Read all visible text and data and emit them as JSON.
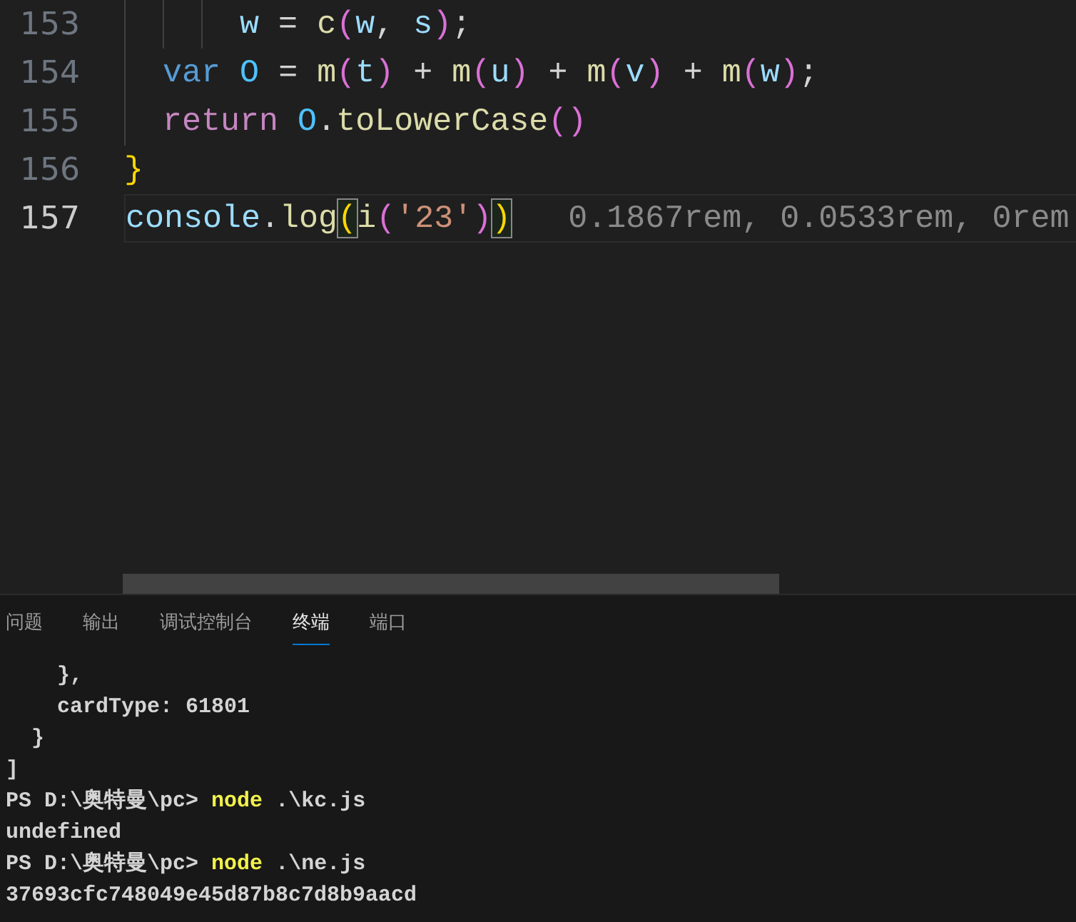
{
  "editor": {
    "lines": [
      {
        "number": "153",
        "current": false,
        "tokens": [
          {
            "kind": "variable",
            "text": "      w"
          },
          {
            "kind": "plain",
            "text": " = "
          },
          {
            "kind": "function",
            "text": "c"
          },
          {
            "kind": "bracket2",
            "text": "("
          },
          {
            "kind": "variable",
            "text": "w"
          },
          {
            "kind": "plain",
            "text": ", "
          },
          {
            "kind": "variable",
            "text": "s"
          },
          {
            "kind": "bracket2",
            "text": ")"
          },
          {
            "kind": "plain",
            "text": ";"
          }
        ]
      },
      {
        "number": "154",
        "current": false,
        "tokens": [
          {
            "kind": "keyword",
            "text": "  var "
          },
          {
            "kind": "constant",
            "text": "O"
          },
          {
            "kind": "plain",
            "text": " = "
          },
          {
            "kind": "function",
            "text": "m"
          },
          {
            "kind": "bracket2",
            "text": "("
          },
          {
            "kind": "variable",
            "text": "t"
          },
          {
            "kind": "bracket2",
            "text": ")"
          },
          {
            "kind": "plain",
            "text": " + "
          },
          {
            "kind": "function",
            "text": "m"
          },
          {
            "kind": "bracket2",
            "text": "("
          },
          {
            "kind": "variable",
            "text": "u"
          },
          {
            "kind": "bracket2",
            "text": ")"
          },
          {
            "kind": "plain",
            "text": " + "
          },
          {
            "kind": "function",
            "text": "m"
          },
          {
            "kind": "bracket2",
            "text": "("
          },
          {
            "kind": "variable",
            "text": "v"
          },
          {
            "kind": "bracket2",
            "text": ")"
          },
          {
            "kind": "plain",
            "text": " + "
          },
          {
            "kind": "function",
            "text": "m"
          },
          {
            "kind": "bracket2",
            "text": "("
          },
          {
            "kind": "variable",
            "text": "w"
          },
          {
            "kind": "bracket2",
            "text": ")"
          },
          {
            "kind": "plain",
            "text": ";"
          }
        ]
      },
      {
        "number": "155",
        "current": false,
        "tokens": [
          {
            "kind": "control",
            "text": "  return "
          },
          {
            "kind": "constant",
            "text": "O"
          },
          {
            "kind": "plain",
            "text": "."
          },
          {
            "kind": "function",
            "text": "toLowerCase"
          },
          {
            "kind": "bracket2",
            "text": "()"
          }
        ]
      },
      {
        "number": "156",
        "current": false,
        "tokens": [
          {
            "kind": "bracket1",
            "text": "}"
          }
        ]
      },
      {
        "number": "157",
        "current": true,
        "tokens": [
          {
            "kind": "variable",
            "text": "console"
          },
          {
            "kind": "plain",
            "text": "."
          },
          {
            "kind": "function",
            "text": "log"
          },
          {
            "kind": "bracket1",
            "text": "(",
            "matched": true
          },
          {
            "kind": "function",
            "text": "i"
          },
          {
            "kind": "bracket2",
            "text": "("
          },
          {
            "kind": "string",
            "text": "'23'"
          },
          {
            "kind": "bracket2",
            "text": ")"
          },
          {
            "kind": "bracket1",
            "text": ")",
            "matched": true
          },
          {
            "kind": "hint",
            "text": "0.1867rem, 0.0533rem, 0rem"
          }
        ]
      }
    ]
  },
  "panel": {
    "tabs": [
      {
        "label": "问题",
        "selected": false
      },
      {
        "label": "输出",
        "selected": false
      },
      {
        "label": "调试控制台",
        "selected": false
      },
      {
        "label": "终端",
        "selected": true
      },
      {
        "label": "端口",
        "selected": false
      }
    ],
    "terminal": [
      [
        {
          "kind": "plain",
          "text": "    },"
        }
      ],
      [
        {
          "kind": "plain",
          "text": "    cardType: 61801"
        }
      ],
      [
        {
          "kind": "plain",
          "text": "  }"
        }
      ],
      [
        {
          "kind": "plain",
          "text": "]"
        }
      ],
      [
        {
          "kind": "plain",
          "text": "PS D:\\奥特曼\\pc> "
        },
        {
          "kind": "command",
          "text": "node"
        },
        {
          "kind": "plain",
          "text": " .\\kc.js"
        }
      ],
      [
        {
          "kind": "plain",
          "text": "undefined"
        }
      ],
      [
        {
          "kind": "plain",
          "text": "PS D:\\奥特曼\\pc> "
        },
        {
          "kind": "command",
          "text": "node"
        },
        {
          "kind": "plain",
          "text": " .\\ne.js"
        }
      ],
      [
        {
          "kind": "plain",
          "text": "37693cfc748049e45d87b8c7d8b9aacd"
        }
      ]
    ]
  }
}
